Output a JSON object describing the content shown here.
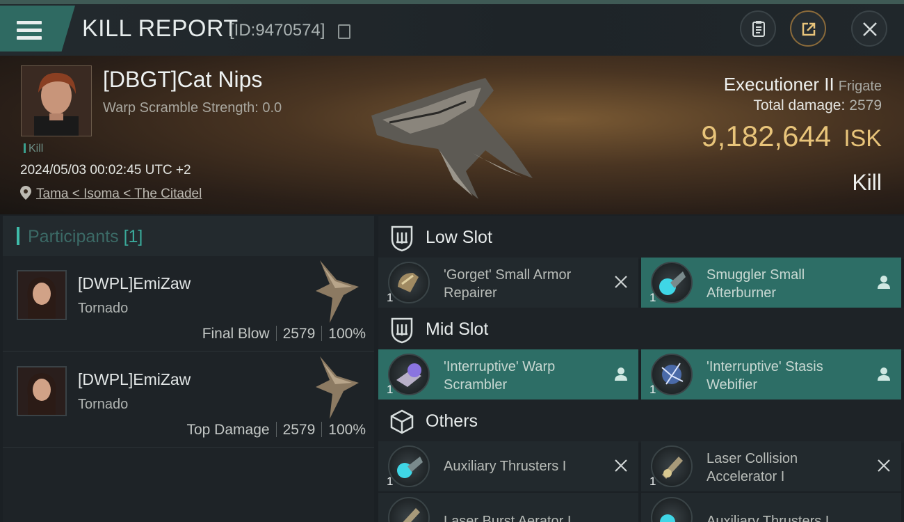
{
  "header": {
    "title": "KILL REPORT",
    "report_id": "[ID:9470574]"
  },
  "victim": {
    "name": "[DBGT]Cat Nips",
    "warp_scramble": "Warp Scramble Strength: 0.0",
    "tag": "Kill",
    "datetime": "2024/05/03 00:02:45 UTC +2",
    "location": "Tama < Isoma < The Citadel"
  },
  "ship": {
    "name": "Executioner II",
    "class": "Frigate",
    "total_damage_label": "Total damage:",
    "total_damage": "2579",
    "isk_value": "9,182,644",
    "isk_unit": "ISK",
    "result": "Kill"
  },
  "participants": {
    "label": "Participants",
    "count": "[1]",
    "items": [
      {
        "name": "[DWPL]EmiZaw",
        "ship": "Tornado",
        "role": "Final Blow",
        "damage": "2579",
        "percent": "100%"
      },
      {
        "name": "[DWPL]EmiZaw",
        "ship": "Tornado",
        "role": "Top Damage",
        "damage": "2579",
        "percent": "100%"
      }
    ]
  },
  "slots": {
    "low": {
      "label": "Low Slot",
      "items": [
        {
          "name": "'Gorget' Small Armor Repairer",
          "qty": "1",
          "state": "destroyed"
        },
        {
          "name": "Smuggler Small Afterburner",
          "qty": "1",
          "state": "dropped"
        }
      ]
    },
    "mid": {
      "label": "Mid Slot",
      "items": [
        {
          "name": "'Interruptive' Warp Scrambler",
          "qty": "1",
          "state": "dropped"
        },
        {
          "name": "'Interruptive' Stasis Webifier",
          "qty": "1",
          "state": "dropped"
        }
      ]
    },
    "others": {
      "label": "Others",
      "items": [
        {
          "name": "Auxiliary Thrusters I",
          "qty": "1",
          "state": "destroyed"
        },
        {
          "name": "Laser Collision Accelerator I",
          "qty": "1",
          "state": "destroyed"
        },
        {
          "name": "Laser Burst Aerator I",
          "qty": "1",
          "state": "destroyed"
        },
        {
          "name": "Auxiliary Thrusters I",
          "qty": "1",
          "state": "destroyed"
        }
      ]
    }
  },
  "icons": {
    "menu": "hamburger-menu-icon",
    "copy": "copy-icon",
    "clipboard": "clipboard-icon",
    "share": "share-icon",
    "close": "close-icon",
    "location": "location-pin-icon",
    "slot": "slot-shield-icon",
    "others": "cube-icon",
    "destroyed": "x-icon",
    "dropped": "person-icon"
  },
  "colors": {
    "accent": "#3fbcaa",
    "isk": "#e8c47a",
    "dropped_bg": "#2d6e66"
  }
}
